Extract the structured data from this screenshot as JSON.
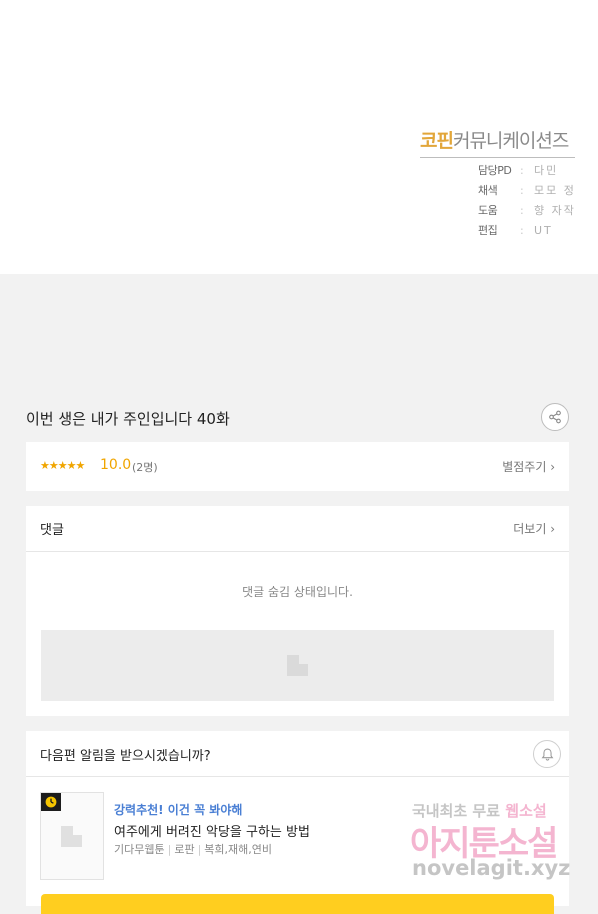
{
  "credits": {
    "studio_part1": "코핀",
    "studio_part2": "커뮤니케이션즈",
    "rows": [
      {
        "role": "담당PD",
        "sep": ":",
        "name": "다민"
      },
      {
        "role": "채색",
        "sep": ":",
        "name": "모모 정"
      },
      {
        "role": "도움",
        "sep": ":",
        "name": "향 자작"
      },
      {
        "role": "편집",
        "sep": ":",
        "name": "UT"
      }
    ]
  },
  "episode": {
    "title": "이번 생은 내가 주인입니다 40화"
  },
  "rating": {
    "stars": "★★★★★",
    "stars_value": 5,
    "score": "10.0",
    "count": "(2명)",
    "action_label": "별점주기 ›"
  },
  "comments": {
    "title": "댓글",
    "more_label": "더보기 ›",
    "hidden_message": "댓글 숨김 상태입니다."
  },
  "notify": {
    "title": "다음편 알림을 받으시겠습니까?",
    "bell_icon": "bell-icon"
  },
  "recommend": {
    "tag": "강력추천! 이건 꼭 봐야해",
    "title": "여주에게 버려진 악당을 구하는 방법",
    "author": "기다무웹툰",
    "genre": "로판",
    "keywords": "복희,재해,연비"
  },
  "watermark": {
    "line1a": "국내최초 무료",
    "line1b": "웹소설",
    "line2": "아지툰소설",
    "line3": "novelagit.xyz"
  },
  "colors": {
    "accent": "#f0a500",
    "link_blue": "#4a7fd4",
    "cta_yellow": "#ffce1f",
    "background": "#f2f2f2"
  }
}
